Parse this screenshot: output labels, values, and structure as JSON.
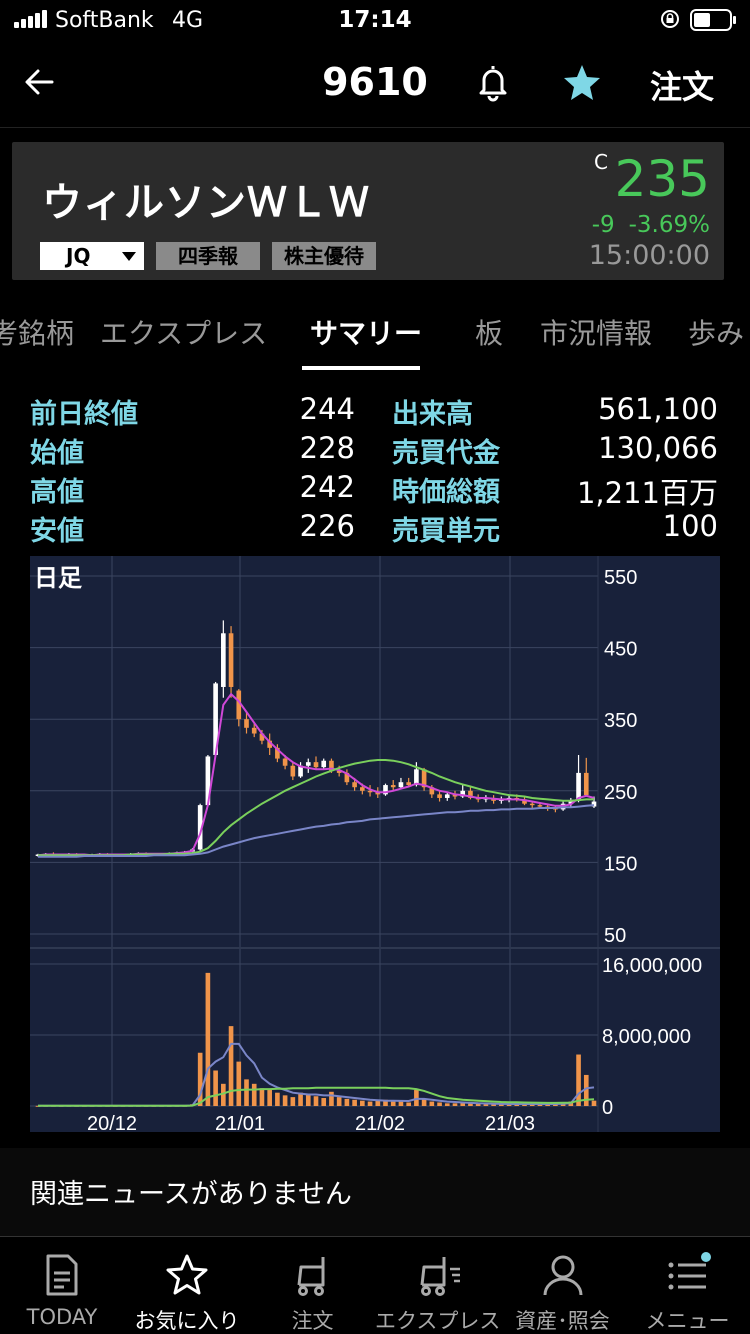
{
  "status": {
    "carrier": "SoftBank",
    "network": "4G",
    "time": "17:14"
  },
  "header": {
    "ticker": "9610",
    "order_label": "注文"
  },
  "stock": {
    "name": "ウィルソンＷＬＷ",
    "market": "JQ",
    "tags": [
      "四季報",
      "株主優待"
    ],
    "price_mark": "C",
    "price": "235",
    "change": "-9",
    "change_pct": "-3.69%",
    "time": "15:00:00",
    "up_color": "#48c85a"
  },
  "tabs": [
    {
      "label": "考銘柄"
    },
    {
      "label": "エクスプレス"
    },
    {
      "label": "サマリー",
      "active": true
    },
    {
      "label": "板"
    },
    {
      "label": "市況情報"
    },
    {
      "label": "歩み"
    }
  ],
  "stats": [
    {
      "label1": "前日終値",
      "value1": "244",
      "label2": "出来高",
      "value2": "561,100"
    },
    {
      "label1": "始値",
      "value1": "228",
      "label2": "売買代金",
      "value2": "130,066"
    },
    {
      "label1": "高値",
      "value1": "242",
      "label2": "時価総額",
      "value2": "1,211百万"
    },
    {
      "label1": "安値",
      "value1": "226",
      "label2": "売買単元",
      "value2": "100"
    }
  ],
  "chart_data": {
    "type": "candlestick",
    "title": "日足",
    "price_axis": {
      "ticks": [
        "550",
        "450",
        "350",
        "250",
        "150",
        "50"
      ],
      "ylim": [
        50,
        550
      ]
    },
    "volume_axis": {
      "ticks": [
        "16,000,000",
        "8,000,000",
        "0"
      ],
      "ylim": [
        0,
        16000000
      ]
    },
    "x_ticks": [
      "20/12",
      "21/01",
      "21/02",
      "21/03"
    ],
    "candles": [
      [
        160,
        162,
        158,
        161
      ],
      [
        161,
        163,
        159,
        162
      ],
      [
        162,
        164,
        160,
        161
      ],
      [
        161,
        162,
        158,
        160
      ],
      [
        160,
        163,
        159,
        162
      ],
      [
        162,
        163,
        160,
        161
      ],
      [
        161,
        162,
        159,
        160
      ],
      [
        160,
        162,
        158,
        161
      ],
      [
        161,
        163,
        160,
        162
      ],
      [
        162,
        163,
        160,
        161
      ],
      [
        161,
        162,
        159,
        160
      ],
      [
        160,
        162,
        159,
        161
      ],
      [
        161,
        163,
        160,
        162
      ],
      [
        162,
        164,
        161,
        163
      ],
      [
        163,
        164,
        161,
        162
      ],
      [
        162,
        163,
        160,
        161
      ],
      [
        161,
        163,
        160,
        162
      ],
      [
        162,
        164,
        161,
        163
      ],
      [
        163,
        165,
        162,
        164
      ],
      [
        164,
        166,
        163,
        165
      ],
      [
        165,
        170,
        164,
        168
      ],
      [
        168,
        232,
        166,
        230
      ],
      [
        230,
        300,
        228,
        298
      ],
      [
        300,
        402,
        298,
        400
      ],
      [
        395,
        488,
        380,
        470
      ],
      [
        470,
        480,
        380,
        395
      ],
      [
        390,
        392,
        340,
        350
      ],
      [
        350,
        360,
        330,
        338
      ],
      [
        338,
        345,
        325,
        330
      ],
      [
        330,
        335,
        315,
        320
      ],
      [
        320,
        330,
        300,
        310
      ],
      [
        310,
        315,
        290,
        295
      ],
      [
        295,
        300,
        280,
        285
      ],
      [
        285,
        290,
        265,
        270
      ],
      [
        270,
        290,
        268,
        285
      ],
      [
        285,
        295,
        275,
        290
      ],
      [
        290,
        298,
        280,
        283
      ],
      [
        283,
        295,
        280,
        292
      ],
      [
        292,
        295,
        275,
        278
      ],
      [
        278,
        285,
        270,
        275
      ],
      [
        275,
        280,
        258,
        262
      ],
      [
        262,
        268,
        250,
        255
      ],
      [
        255,
        260,
        245,
        250
      ],
      [
        250,
        258,
        242,
        248
      ],
      [
        248,
        255,
        240,
        245
      ],
      [
        245,
        260,
        243,
        258
      ],
      [
        258,
        265,
        250,
        255
      ],
      [
        255,
        268,
        252,
        262
      ],
      [
        262,
        268,
        255,
        258
      ],
      [
        258,
        290,
        256,
        280
      ],
      [
        280,
        282,
        250,
        255
      ],
      [
        255,
        258,
        240,
        245
      ],
      [
        245,
        250,
        235,
        240
      ],
      [
        240,
        248,
        236,
        245
      ],
      [
        245,
        250,
        238,
        242
      ],
      [
        242,
        258,
        240,
        250
      ],
      [
        250,
        255,
        238,
        240
      ],
      [
        240,
        245,
        234,
        238
      ],
      [
        238,
        244,
        234,
        240
      ],
      [
        240,
        244,
        232,
        236
      ],
      [
        236,
        242,
        232,
        238
      ],
      [
        238,
        244,
        234,
        240
      ],
      [
        240,
        245,
        235,
        238
      ],
      [
        238,
        242,
        230,
        232
      ],
      [
        232,
        236,
        226,
        230
      ],
      [
        230,
        234,
        225,
        228
      ],
      [
        228,
        232,
        222,
        226
      ],
      [
        226,
        230,
        220,
        224
      ],
      [
        224,
        235,
        222,
        232
      ],
      [
        232,
        240,
        228,
        236
      ],
      [
        236,
        300,
        234,
        275
      ],
      [
        275,
        296,
        242,
        244
      ],
      [
        228,
        242,
        226,
        235
      ]
    ],
    "volumes": [
      20000,
      30000,
      25000,
      20000,
      30000,
      22000,
      20000,
      18000,
      25000,
      22000,
      20000,
      22000,
      24000,
      26000,
      22000,
      20000,
      24000,
      22000,
      26000,
      30000,
      200000,
      6000000,
      15000000,
      4000000,
      2500000,
      9000000,
      5000000,
      3000000,
      2500000,
      2000000,
      1800000,
      1500000,
      1200000,
      1000000,
      1500000,
      1300000,
      1100000,
      900000,
      1600000,
      1000000,
      800000,
      700000,
      600000,
      500000,
      600000,
      700000,
      500000,
      600000,
      400000,
      1800000,
      800000,
      500000,
      400000,
      300000,
      300000,
      400000,
      300000,
      250000,
      200000,
      250000,
      200000,
      200000,
      300000,
      250000,
      200000,
      200000,
      250000,
      200000,
      400000,
      500000,
      5800000,
      3500000,
      600000
    ],
    "series": [
      {
        "values": [
          160,
          161,
          161,
          161,
          161,
          161,
          161,
          160,
          161,
          161,
          161,
          161,
          161,
          162,
          162,
          162,
          162,
          162,
          163,
          164,
          166,
          190,
          230,
          300,
          370,
          385,
          375,
          360,
          345,
          330,
          318,
          308,
          298,
          290,
          284,
          282,
          280,
          280,
          281,
          279,
          274,
          266,
          258,
          252,
          248,
          248,
          250,
          253,
          256,
          260,
          258,
          254,
          250,
          248,
          245,
          244,
          242,
          240,
          240,
          239,
          238,
          238,
          238,
          237,
          235,
          233,
          231,
          229,
          229,
          231,
          240,
          243,
          240
        ],
        "color": "#d048d8"
      },
      {
        "values": [
          160,
          160,
          160,
          160,
          160,
          160,
          160,
          160,
          160,
          160,
          160,
          160,
          161,
          161,
          161,
          161,
          161,
          162,
          162,
          162,
          163,
          165,
          170,
          180,
          192,
          202,
          210,
          218,
          225,
          232,
          238,
          244,
          250,
          255,
          260,
          265,
          270,
          274,
          278,
          282,
          285,
          288,
          290,
          292,
          293,
          293,
          292,
          290,
          287,
          283,
          279,
          275,
          270,
          266,
          262,
          259,
          256,
          253,
          250,
          248,
          246,
          244,
          243,
          242,
          240,
          239,
          238,
          237,
          236,
          236,
          237,
          238,
          238
        ],
        "color": "#7ad05c"
      },
      {
        "values": [
          158,
          158,
          158,
          158,
          158,
          158,
          159,
          159,
          159,
          159,
          159,
          159,
          159,
          159,
          159,
          160,
          160,
          160,
          160,
          160,
          161,
          162,
          164,
          168,
          172,
          175,
          178,
          181,
          184,
          186,
          188,
          190,
          192,
          194,
          196,
          198,
          200,
          201,
          203,
          204,
          206,
          207,
          208,
          210,
          211,
          212,
          213,
          214,
          215,
          216,
          217,
          218,
          219,
          220,
          220,
          221,
          222,
          222,
          223,
          223,
          224,
          224,
          225,
          225,
          225,
          226,
          226,
          226,
          227,
          227,
          228,
          229,
          230
        ],
        "color": "#7a86c8"
      }
    ],
    "volume_series": [
      {
        "values": [
          25000,
          25000,
          25000,
          24000,
          24000,
          24000,
          23000,
          23000,
          23000,
          23000,
          23000,
          22000,
          22000,
          23000,
          23000,
          23000,
          23000,
          23000,
          23000,
          24000,
          60000,
          1250000,
          4200000,
          5000000,
          5500000,
          7000000,
          7000000,
          5700000,
          4800000,
          3200000,
          2500000,
          2100000,
          1800000,
          1500000,
          1400000,
          1300000,
          1300000,
          1200000,
          1200000,
          1100000,
          1000000,
          900000,
          800000,
          700000,
          650000,
          600000,
          600000,
          580000,
          560000,
          800000,
          800000,
          700000,
          600000,
          500000,
          450000,
          400000,
          350000,
          300000,
          280000,
          260000,
          240000,
          230000,
          230000,
          230000,
          230000,
          220000,
          220000,
          220000,
          260000,
          320000,
          1400000,
          2000000,
          2100000
        ],
        "color": "#7a86c8"
      },
      {
        "values": [
          25000,
          25000,
          25000,
          25000,
          25000,
          25000,
          25000,
          25000,
          25000,
          25000,
          25000,
          25000,
          25000,
          25000,
          25000,
          25000,
          25000,
          25000,
          25000,
          25000,
          40000,
          350000,
          1000000,
          1200000,
          1400000,
          1700000,
          1800000,
          1850000,
          1850000,
          1900000,
          1900000,
          1950000,
          1950000,
          2000000,
          2000000,
          2000000,
          2050000,
          2050000,
          2050000,
          2050000,
          2050000,
          2050000,
          2050000,
          2050000,
          2050000,
          2050000,
          2000000,
          2000000,
          2000000,
          1900000,
          1700000,
          1400000,
          1100000,
          900000,
          800000,
          700000,
          650000,
          600000,
          550000,
          500000,
          450000,
          430000,
          420000,
          400000,
          380000,
          360000,
          350000,
          350000,
          360000,
          380000,
          600000,
          700000,
          750000
        ],
        "color": "#7ad05c"
      }
    ],
    "colors": {
      "up": "#ffffff",
      "down": "#f0944a",
      "background": "#18213a",
      "grid": "#3a4560"
    }
  },
  "news": {
    "text": "関連ニュースがありません"
  },
  "nav": [
    {
      "label": "TODAY",
      "icon": "today-icon"
    },
    {
      "label": "お気に入り",
      "icon": "favorites-star-icon",
      "active": true
    },
    {
      "label": "注文",
      "icon": "cart-icon"
    },
    {
      "label": "エクスプレス",
      "icon": "express-cart-icon"
    },
    {
      "label": "資産･照会",
      "icon": "person-icon"
    },
    {
      "label": "メニュー",
      "icon": "menu-icon"
    }
  ]
}
